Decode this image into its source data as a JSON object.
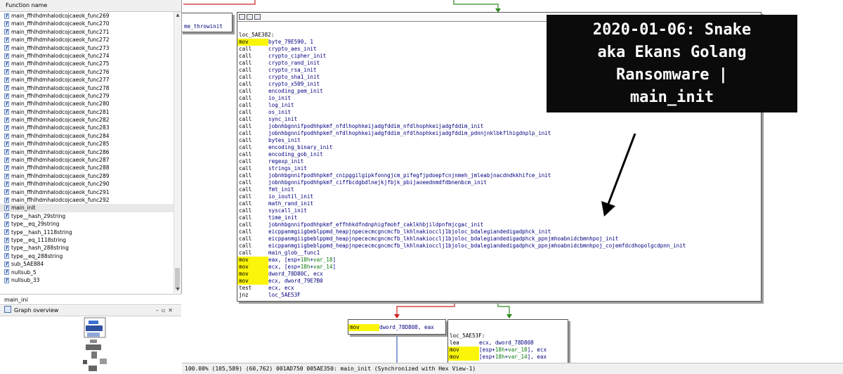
{
  "functions_panel": {
    "header": "Function name",
    "items": [
      "main_ffhlhdmhalodcojcaeok_func269",
      "main_ffhlhdmhalodcojcaeok_func270",
      "main_ffhlhdmhalodcojcaeok_func271",
      "main_ffhlhdmhalodcojcaeok_func272",
      "main_ffhlhdmhalodcojcaeok_func273",
      "main_ffhlhdmhalodcojcaeok_func274",
      "main_ffhlhdmhalodcojcaeok_func275",
      "main_ffhlhdmhalodcojcaeok_func276",
      "main_ffhlhdmhalodcojcaeok_func277",
      "main_ffhlhdmhalodcojcaeok_func278",
      "main_ffhlhdmhalodcojcaeok_func279",
      "main_ffhlhdmhalodcojcaeok_func280",
      "main_ffhlhdmhalodcojcaeok_func281",
      "main_ffhlhdmhalodcojcaeok_func282",
      "main_ffhlhdmhalodcojcaeok_func283",
      "main_ffhlhdmhalodcojcaeok_func284",
      "main_ffhlhdmhalodcojcaeok_func285",
      "main_ffhlhdmhalodcojcaeok_func286",
      "main_ffhlhdmhalodcojcaeok_func287",
      "main_ffhlhdmhalodcojcaeok_func288",
      "main_ffhlhdmhalodcojcaeok_func289",
      "main_ffhlhdmhalodcojcaeok_func290",
      "main_ffhlhdmhalodcojcaeok_func291",
      "main_ffhlhdmhalodcojcaeok_func292",
      "main_init",
      "type__hash_29string",
      "type__eq_29string",
      "type__hash_1118string",
      "type__eq_1118string",
      "type__hash_288string",
      "type__eq_288string",
      "sub_5AE884",
      "nullsub_5",
      "nullsub_33"
    ],
    "selected": "main_init"
  },
  "search": {
    "value": "main_ini"
  },
  "overview": {
    "title": "Graph overview"
  },
  "graph": {
    "top_node_label": "me_throwinit",
    "main_node": {
      "label": "loc_5AE382:",
      "lines": [
        {
          "m": "mov",
          "o": "byte_79E590, 1",
          "y": true
        },
        {
          "m": "call",
          "o": "crypto_aes_init"
        },
        {
          "m": "call",
          "o": "crypto_cipher_init"
        },
        {
          "m": "call",
          "o": "crypto_rand_init"
        },
        {
          "m": "call",
          "o": "crypto_rsa_init"
        },
        {
          "m": "call",
          "o": "crypto_sha1_init"
        },
        {
          "m": "call",
          "o": "crypto_x509_init"
        },
        {
          "m": "call",
          "o": "encoding_pem_init"
        },
        {
          "m": "call",
          "o": "io_init"
        },
        {
          "m": "call",
          "o": "log_init"
        },
        {
          "m": "call",
          "o": "os_init"
        },
        {
          "m": "call",
          "o": "sync_init"
        },
        {
          "m": "call",
          "o": "jobnhbgnnifpodhhpkmf_nfdlhophkeijadgfddim_nfdlhophkeijadgfddim_init"
        },
        {
          "m": "call",
          "o": "jobnhbgnnifpodhhpkmf_nfdlhophkeijadgfddim_nfdlhophkeijadgfddim_pdnnjnklbkflhigdnplp_init"
        },
        {
          "m": "call",
          "o": "bytes_init"
        },
        {
          "m": "call",
          "o": "encoding_binary_init"
        },
        {
          "m": "call",
          "o": "encoding_gob_init"
        },
        {
          "m": "call",
          "o": "regexp_init"
        },
        {
          "m": "call",
          "o": "strings_init"
        },
        {
          "m": "call",
          "o": "jobnhbgnnifpodhhpkmf_cnipggilgipkfonngjcm_pifegfjpdoepfcnjnmeh_jmleabjnacdndkkhifce_init"
        },
        {
          "m": "call",
          "o": "jobnhbgnnifpodhhpkmf_ciffbcdgbdlnejkjfbjk_pbijaoeednmdfdbnenbcm_init"
        },
        {
          "m": "call",
          "o": "fmt_init"
        },
        {
          "m": "call",
          "o": "io_ioutil_init"
        },
        {
          "m": "call",
          "o": "math_rand_init"
        },
        {
          "m": "call",
          "o": "syscall_init"
        },
        {
          "m": "call",
          "o": "time_init"
        },
        {
          "m": "call",
          "o": "jobnhbgnnifpodhhpkmf_effhhkdfndnphigfmohf_caklkhbjildpnfmjcgac_init"
        },
        {
          "m": "call",
          "o": "eicppanmgiigbeblppmd_heapjnpececmcgncmcfb_lkhlnakiocclj1bjoloc_bdalegiandedigadphck_init"
        },
        {
          "m": "call",
          "o": "eicppanmgiigbeblppmd_heapjnpececmcgncmcfb_lkhlnakiocclj1bjoloc_bdalegiandedigadphck_ppnjmhoabnidcbmnhpoj_init"
        },
        {
          "m": "call",
          "o": "eicppanmgiigbeblppmd_heapjnpececmcgncmcfb_lkhlnakiocclj1bjoloc_bdalegiandedigadphck_ppnjmhoabnidcbmnhpoj_cojemfdcdhopolgcdpnn_init"
        },
        {
          "m": "call",
          "o": "main_glob__func1"
        },
        {
          "m": "mov",
          "o": "eax, [esp+18h+var_18]",
          "y": true
        },
        {
          "m": "mov",
          "o": "ecx, [esp+18h+var_14]",
          "y": true
        },
        {
          "m": "mov",
          "o": "dword_78D80C, ecx",
          "y": true
        },
        {
          "m": "mov",
          "o": "ecx, dword_79E7B0",
          "y": true
        },
        {
          "m": "test",
          "o": "ecx, ecx"
        },
        {
          "m": "jnz",
          "o": "loc_5AE53F"
        }
      ]
    },
    "left_node": {
      "lines": [
        {
          "m": "mov",
          "o": "dword_78D808, eax",
          "y": true
        }
      ]
    },
    "right_node": {
      "label": "loc_5AE53F:",
      "lines": [
        {
          "m": "lea",
          "o": "ecx, dword_78D808"
        },
        {
          "m": "mov",
          "o": "[esp+18h+var_18], ecx",
          "y": true
        },
        {
          "m": "mov",
          "o": "[esp+18h+var_14], eax",
          "y": true
        }
      ]
    }
  },
  "status_bar": "100.00% (105,589) (60,762) 001AD750 005AE350: main_init (Synchronized with Hex View-1)",
  "annotation": {
    "line1": "2020-01-06: Snake",
    "line2": "aka Ekans Golang",
    "line3": "Ransomware |",
    "line4": "main_init"
  },
  "colors": {
    "mnemonic_highlight": "#fbf50a",
    "operand": "#000080",
    "edge_true": "#2e8b1e",
    "edge_false": "#d02020",
    "edge_normal": "#1c3fa8",
    "annotation_bg": "#0b0b0b"
  }
}
